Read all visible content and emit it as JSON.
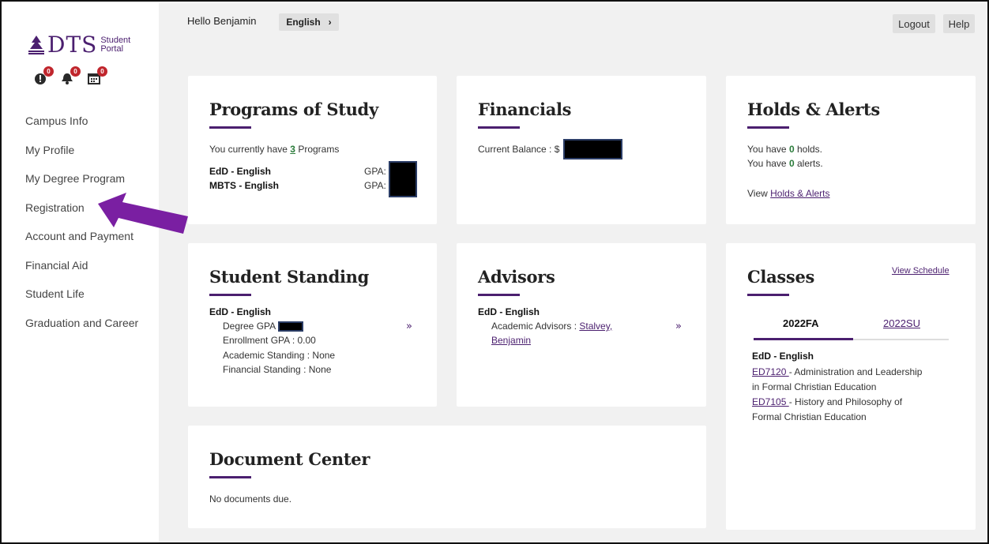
{
  "sidebar": {
    "logo": {
      "main": "DTS",
      "sub1": "Student",
      "sub2": "Portal"
    },
    "notifications": [
      {
        "icon": "alert-icon",
        "count": "0"
      },
      {
        "icon": "bell-icon",
        "count": "0"
      },
      {
        "icon": "calendar-icon",
        "count": "0"
      }
    ],
    "items": [
      {
        "label": "Campus Info"
      },
      {
        "label": "My Profile"
      },
      {
        "label": "My Degree Program"
      },
      {
        "label": "Registration"
      },
      {
        "label": "Account and Payment"
      },
      {
        "label": "Financial Aid"
      },
      {
        "label": "Student Life"
      },
      {
        "label": "Graduation and Career"
      }
    ]
  },
  "header": {
    "greeting": "Hello Benjamin",
    "language": "English",
    "language_arrow": "›",
    "logout": "Logout",
    "help": "Help"
  },
  "programs": {
    "title": "Programs of Study",
    "summary_prefix": "You currently have ",
    "count": "3",
    "summary_suffix": " Programs",
    "rows": [
      {
        "name": "EdD - English",
        "gpa_label": "GPA:"
      },
      {
        "name": "MBTS - English",
        "gpa_label": "GPA:"
      }
    ]
  },
  "financials": {
    "title": "Financials",
    "balance_label": "Current Balance : $"
  },
  "holds": {
    "title": "Holds & Alerts",
    "holds_prefix": "You have ",
    "holds_count": "0",
    "holds_suffix": " holds.",
    "alerts_prefix": "You have ",
    "alerts_count": "0",
    "alerts_suffix": " alerts.",
    "view_prefix": "View ",
    "view_link": "Holds & Alerts"
  },
  "standing": {
    "title": "Student Standing",
    "program": "EdD - English",
    "degree_gpa_label": "Degree GPA",
    "enrollment_gpa": "Enrollment GPA : 0.00",
    "academic_standing": "Academic Standing : None",
    "financial_standing": "Financial Standing : None"
  },
  "advisors": {
    "title": "Advisors",
    "program": "EdD - English",
    "label": "Academic Advisors : ",
    "name_line1": "Stalvey,",
    "name_line2": "Benjamin"
  },
  "classes": {
    "title": "Classes",
    "view_schedule": "View Schedule",
    "tabs": [
      {
        "label": "2022FA"
      },
      {
        "label": "2022SU"
      }
    ],
    "program": "EdD - English",
    "courses": [
      {
        "code": "ED7120 ",
        "line1": "- Administration and Leadership",
        "line2": "in Formal Christian Education"
      },
      {
        "code": "ED7105 ",
        "line1": "- History and Philosophy of",
        "line2": "Formal Christian Education"
      }
    ]
  },
  "documents": {
    "title": "Document Center",
    "message": "No documents due."
  },
  "colors": {
    "accent": "#4b1f6f",
    "arrow": "#7a1fa2",
    "badge": "#c0262d",
    "count_green": "#2a7b3a"
  }
}
